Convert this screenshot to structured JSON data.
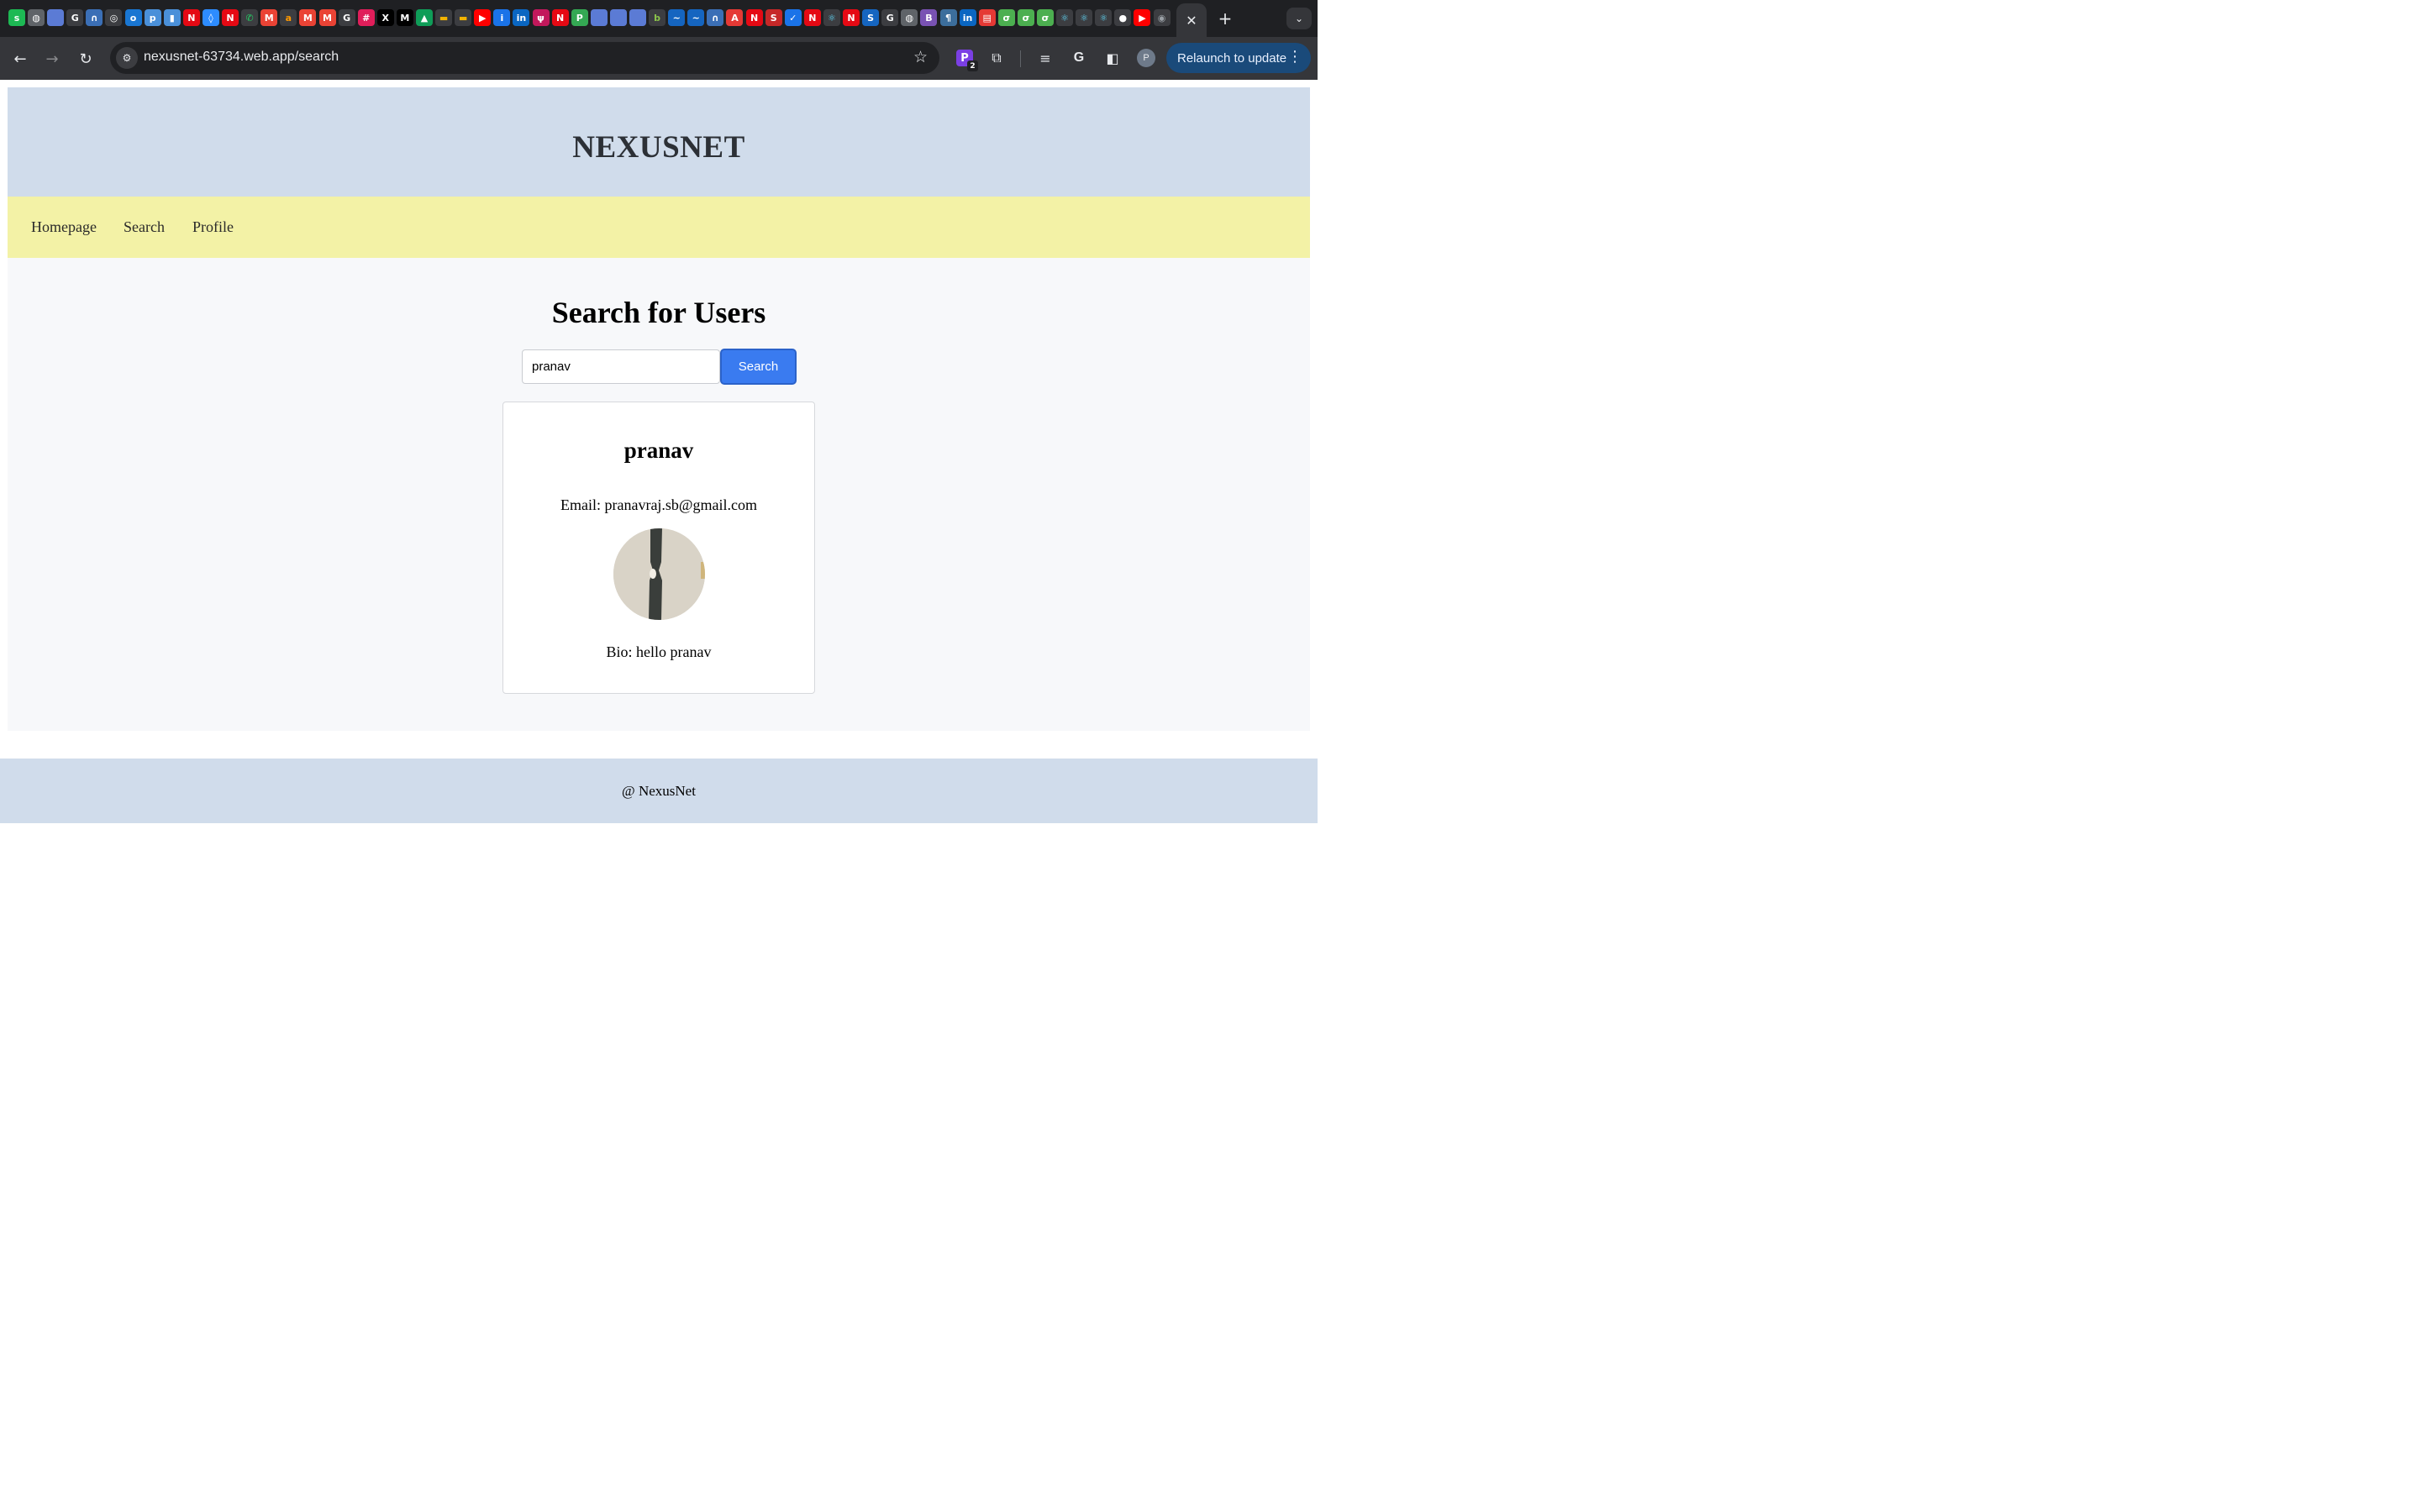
{
  "browser": {
    "tab_icons": [
      {
        "name": "spotify-icon",
        "glyph": "s",
        "color": "#1db954"
      },
      {
        "name": "globe-icon",
        "glyph": "◍",
        "color": "#5f6368"
      },
      {
        "name": "doc-icon",
        "glyph": "",
        "color": "#5b7bd5"
      },
      {
        "name": "google-icon",
        "glyph": "G",
        "color": "#ffffff"
      },
      {
        "name": "headphones-icon",
        "glyph": "∩",
        "color": "#3b6fb6"
      },
      {
        "name": "camera-icon",
        "glyph": "◎",
        "color": "#ffffff"
      },
      {
        "name": "outlook-icon",
        "glyph": "o",
        "color": "#1976d2"
      },
      {
        "name": "parking-icon",
        "glyph": "p",
        "color": "#4a90d9"
      },
      {
        "name": "chart-icon",
        "glyph": "▮",
        "color": "#4a90d9"
      },
      {
        "name": "netflix-icon",
        "glyph": "N",
        "color": "#e50914"
      },
      {
        "name": "bulb-icon",
        "glyph": "◊",
        "color": "#2d8cff"
      },
      {
        "name": "netflix-icon",
        "glyph": "N",
        "color": "#e50914"
      },
      {
        "name": "whatsapp-icon",
        "glyph": "✆",
        "color": "#25d366"
      },
      {
        "name": "gmail-icon",
        "glyph": "M",
        "color": "#ea4335"
      },
      {
        "name": "amazon-icon",
        "glyph": "a",
        "color": "#ff9900"
      },
      {
        "name": "gmail-icon",
        "glyph": "M",
        "color": "#ea4335"
      },
      {
        "name": "gmail-icon",
        "glyph": "M",
        "color": "#ea4335"
      },
      {
        "name": "google-icon",
        "glyph": "G",
        "color": "#ffffff"
      },
      {
        "name": "slack-icon",
        "glyph": "#",
        "color": "#e01e5a"
      },
      {
        "name": "x-icon",
        "glyph": "X",
        "color": "#000000"
      },
      {
        "name": "medium-icon",
        "glyph": "M",
        "color": "#000000"
      },
      {
        "name": "drive-icon",
        "glyph": "▲",
        "color": "#0f9d58"
      },
      {
        "name": "slides-icon",
        "glyph": "▬",
        "color": "#f4b400"
      },
      {
        "name": "slides-icon",
        "glyph": "▬",
        "color": "#f4b400"
      },
      {
        "name": "youtube-icon",
        "glyph": "▶",
        "color": "#ff0000"
      },
      {
        "name": "info-icon",
        "glyph": "i",
        "color": "#1a73e8"
      },
      {
        "name": "linkedin-icon",
        "glyph": "in",
        "color": "#0a66c2"
      },
      {
        "name": "trophy-icon",
        "glyph": "ψ",
        "color": "#c2185b"
      },
      {
        "name": "netflix-icon",
        "glyph": "N",
        "color": "#e50914"
      },
      {
        "name": "p-logo-icon",
        "glyph": "P",
        "color": "#34a853"
      },
      {
        "name": "doc-icon",
        "glyph": "",
        "color": "#5b7bd5"
      },
      {
        "name": "doc-icon",
        "glyph": "",
        "color": "#5b7bd5"
      },
      {
        "name": "doc-icon",
        "glyph": "",
        "color": "#5b7bd5"
      },
      {
        "name": "leaf-icon",
        "glyph": "b",
        "color": "#8bc34a"
      },
      {
        "name": "wave-icon",
        "glyph": "~",
        "color": "#1565c0"
      },
      {
        "name": "wave-icon",
        "glyph": "~",
        "color": "#1565c0"
      },
      {
        "name": "headphones-icon",
        "glyph": "∩",
        "color": "#3b6fb6"
      },
      {
        "name": "adobe-icon",
        "glyph": "A",
        "color": "#e53935"
      },
      {
        "name": "netflix-icon",
        "glyph": "N",
        "color": "#e50914"
      },
      {
        "name": "s-logo-icon",
        "glyph": "S",
        "color": "#c62828"
      },
      {
        "name": "check-icon",
        "glyph": "✓",
        "color": "#1a73e8"
      },
      {
        "name": "netflix-icon",
        "glyph": "N",
        "color": "#e50914"
      },
      {
        "name": "react-icon",
        "glyph": "⚛",
        "color": "#61dafb"
      },
      {
        "name": "netflix-icon",
        "glyph": "N",
        "color": "#e50914"
      },
      {
        "name": "s-logo-icon",
        "glyph": "S",
        "color": "#1565c0"
      },
      {
        "name": "google-icon",
        "glyph": "G",
        "color": "#ffffff"
      },
      {
        "name": "globe-icon",
        "glyph": "◍",
        "color": "#5f6368"
      },
      {
        "name": "bootstrap-icon",
        "glyph": "B",
        "color": "#7952b3"
      },
      {
        "name": "code-icon",
        "glyph": "¶",
        "color": "#3c6e9c"
      },
      {
        "name": "linkedin-icon",
        "glyph": "in",
        "color": "#0a66c2"
      },
      {
        "name": "calendar-icon",
        "glyph": "▤",
        "color": "#e53935"
      },
      {
        "name": "mongodb-icon",
        "glyph": "σ",
        "color": "#4caf50"
      },
      {
        "name": "mongodb-icon",
        "glyph": "σ",
        "color": "#4caf50"
      },
      {
        "name": "mongodb-icon",
        "glyph": "σ",
        "color": "#4caf50"
      },
      {
        "name": "react-icon",
        "glyph": "⚛",
        "color": "#61dafb"
      },
      {
        "name": "react-icon",
        "glyph": "⚛",
        "color": "#61dafb"
      },
      {
        "name": "react-icon",
        "glyph": "⚛",
        "color": "#61dafb"
      },
      {
        "name": "github-icon",
        "glyph": "●",
        "color": "#ffffff"
      },
      {
        "name": "youtube-icon",
        "glyph": "▶",
        "color": "#ff0000"
      },
      {
        "name": "chrome-icon",
        "glyph": "◉",
        "color": "#9aa0a6"
      }
    ],
    "active_tab_close": "✕",
    "new_tab": "+",
    "tab_search": "⌄",
    "url": "nexusnet-63734.web.app/search",
    "extension_badge": "P",
    "extension_badge_count": "2",
    "profile_initial": "P",
    "relaunch_label": "Relaunch to update"
  },
  "site": {
    "title": "NEXUSNET",
    "nav": [
      {
        "label": "Homepage"
      },
      {
        "label": "Search"
      },
      {
        "label": "Profile"
      }
    ],
    "footer": "@ NexusNet"
  },
  "search_page": {
    "heading": "Search for Users",
    "query": "pranav",
    "button_label": "Search",
    "result": {
      "name": "pranav",
      "email": "Email: pranavraj.sb@gmail.com",
      "bio": "Bio: hello pranav"
    }
  }
}
